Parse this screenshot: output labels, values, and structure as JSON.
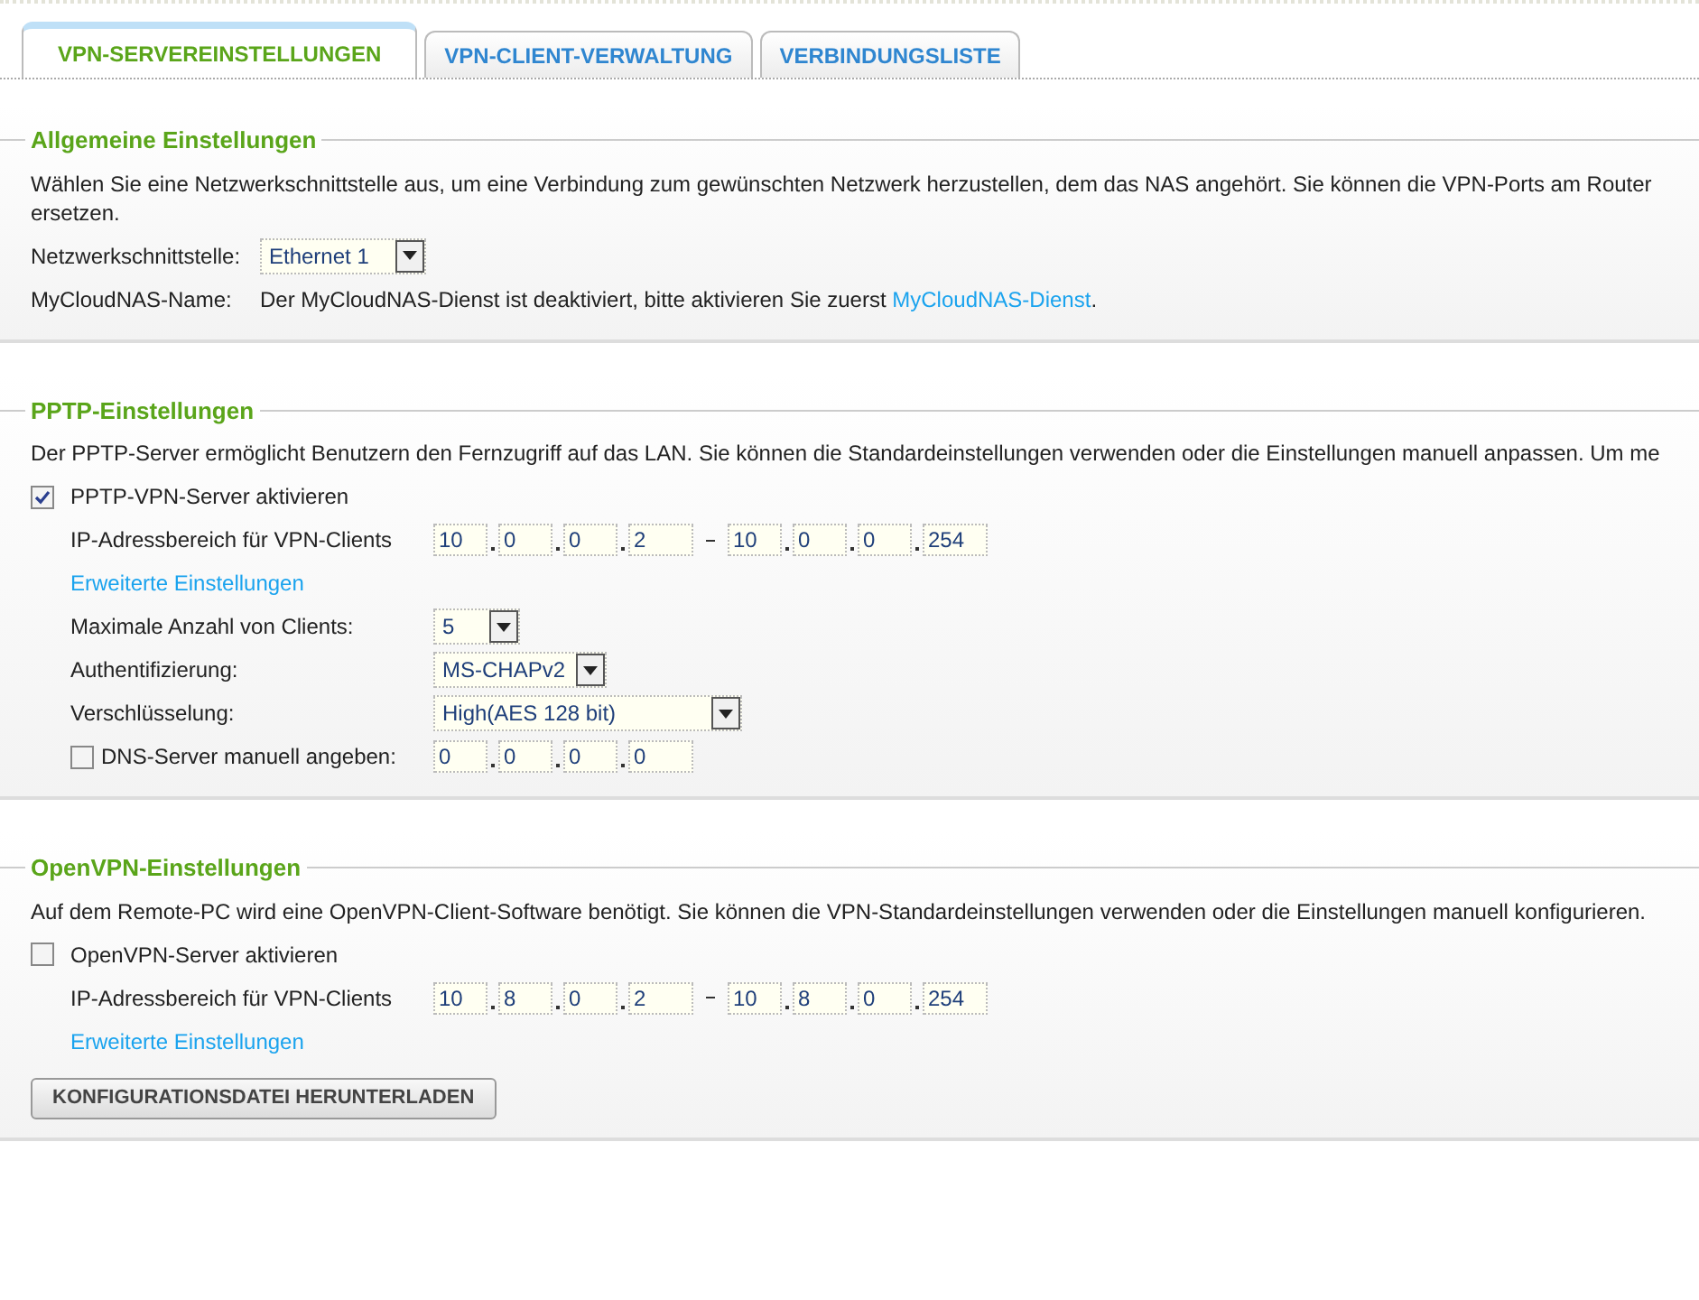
{
  "tabs": [
    {
      "label": "VPN-SERVEREINSTELLUNGEN",
      "selected": true
    },
    {
      "label": "VPN-CLIENT-VERWALTUNG",
      "selected": false
    },
    {
      "label": "VERBINDUNGSLISTE",
      "selected": false
    }
  ],
  "sections": [
    {
      "title": "Allgemeine Einstellungen",
      "description_lines": [
        "Wählen Sie eine Netzwerkschnittstelle aus, um eine Verbindung zum gewünschten Netzwerk herzustellen, dem das NAS angehört. Sie können die VPN-Ports am Router",
        "ersetzen."
      ],
      "rows": [
        {
          "kind": "select",
          "label": "Netzwerkschnittstelle:",
          "value": "Ethernet 1"
        },
        {
          "kind": "info",
          "label": "MyCloudNAS-Name:",
          "text": "Der MyCloudNAS-Dienst ist deaktiviert, bitte aktivieren Sie zuerst ",
          "link": "MyCloudNAS-Dienst",
          "suffix": "."
        }
      ]
    },
    {
      "title": "PPTP-Einstellungen",
      "description_lines": [
        "Der PPTP-Server ermöglicht Benutzern den Fernzugriff auf das LAN. Sie können die Standardeinstellungen verwenden oder die Einstellungen manuell anpassen. Um me"
      ],
      "rows": [
        {
          "kind": "checkbox",
          "label": "PPTP-VPN-Server aktivieren",
          "checked": true
        },
        {
          "kind": "ip_range",
          "label": "IP-Adressbereich für VPN-Clients",
          "from": [
            "10",
            "0",
            "0",
            "2"
          ],
          "to": [
            "10",
            "0",
            "0",
            "254"
          ]
        },
        {
          "kind": "link",
          "label": "Erweiterte Einstellungen"
        },
        {
          "kind": "sub_select",
          "label": "Maximale Anzahl von Clients:",
          "value": "5"
        },
        {
          "kind": "sub_select",
          "label": "Authentifizierung:",
          "value": "MS-CHAPv2"
        },
        {
          "kind": "sub_select_wide",
          "label": "Verschlüsselung:",
          "value": "High(AES 128 bit)"
        },
        {
          "kind": "check_ip",
          "label": "DNS-Server manuell angeben:",
          "checked": false,
          "ip": [
            "0",
            "0",
            "0",
            "0"
          ]
        }
      ]
    },
    {
      "title": "OpenVPN-Einstellungen",
      "description_lines": [
        "Auf dem Remote-PC wird eine OpenVPN-Client-Software benötigt. Sie können die VPN-Standardeinstellungen verwenden oder die Einstellungen manuell konfigurieren."
      ],
      "rows": [
        {
          "kind": "checkbox",
          "label": "OpenVPN-Server aktivieren",
          "checked": false
        },
        {
          "kind": "ip_range",
          "label": "IP-Adressbereich für VPN-Clients",
          "from": [
            "10",
            "8",
            "0",
            "2"
          ],
          "to": [
            "10",
            "8",
            "0",
            "254"
          ]
        },
        {
          "kind": "link",
          "label": "Erweiterte Einstellungen"
        },
        {
          "kind": "button",
          "label": "KONFIGURATIONSDATEI HERUNTERLADEN"
        }
      ]
    }
  ]
}
